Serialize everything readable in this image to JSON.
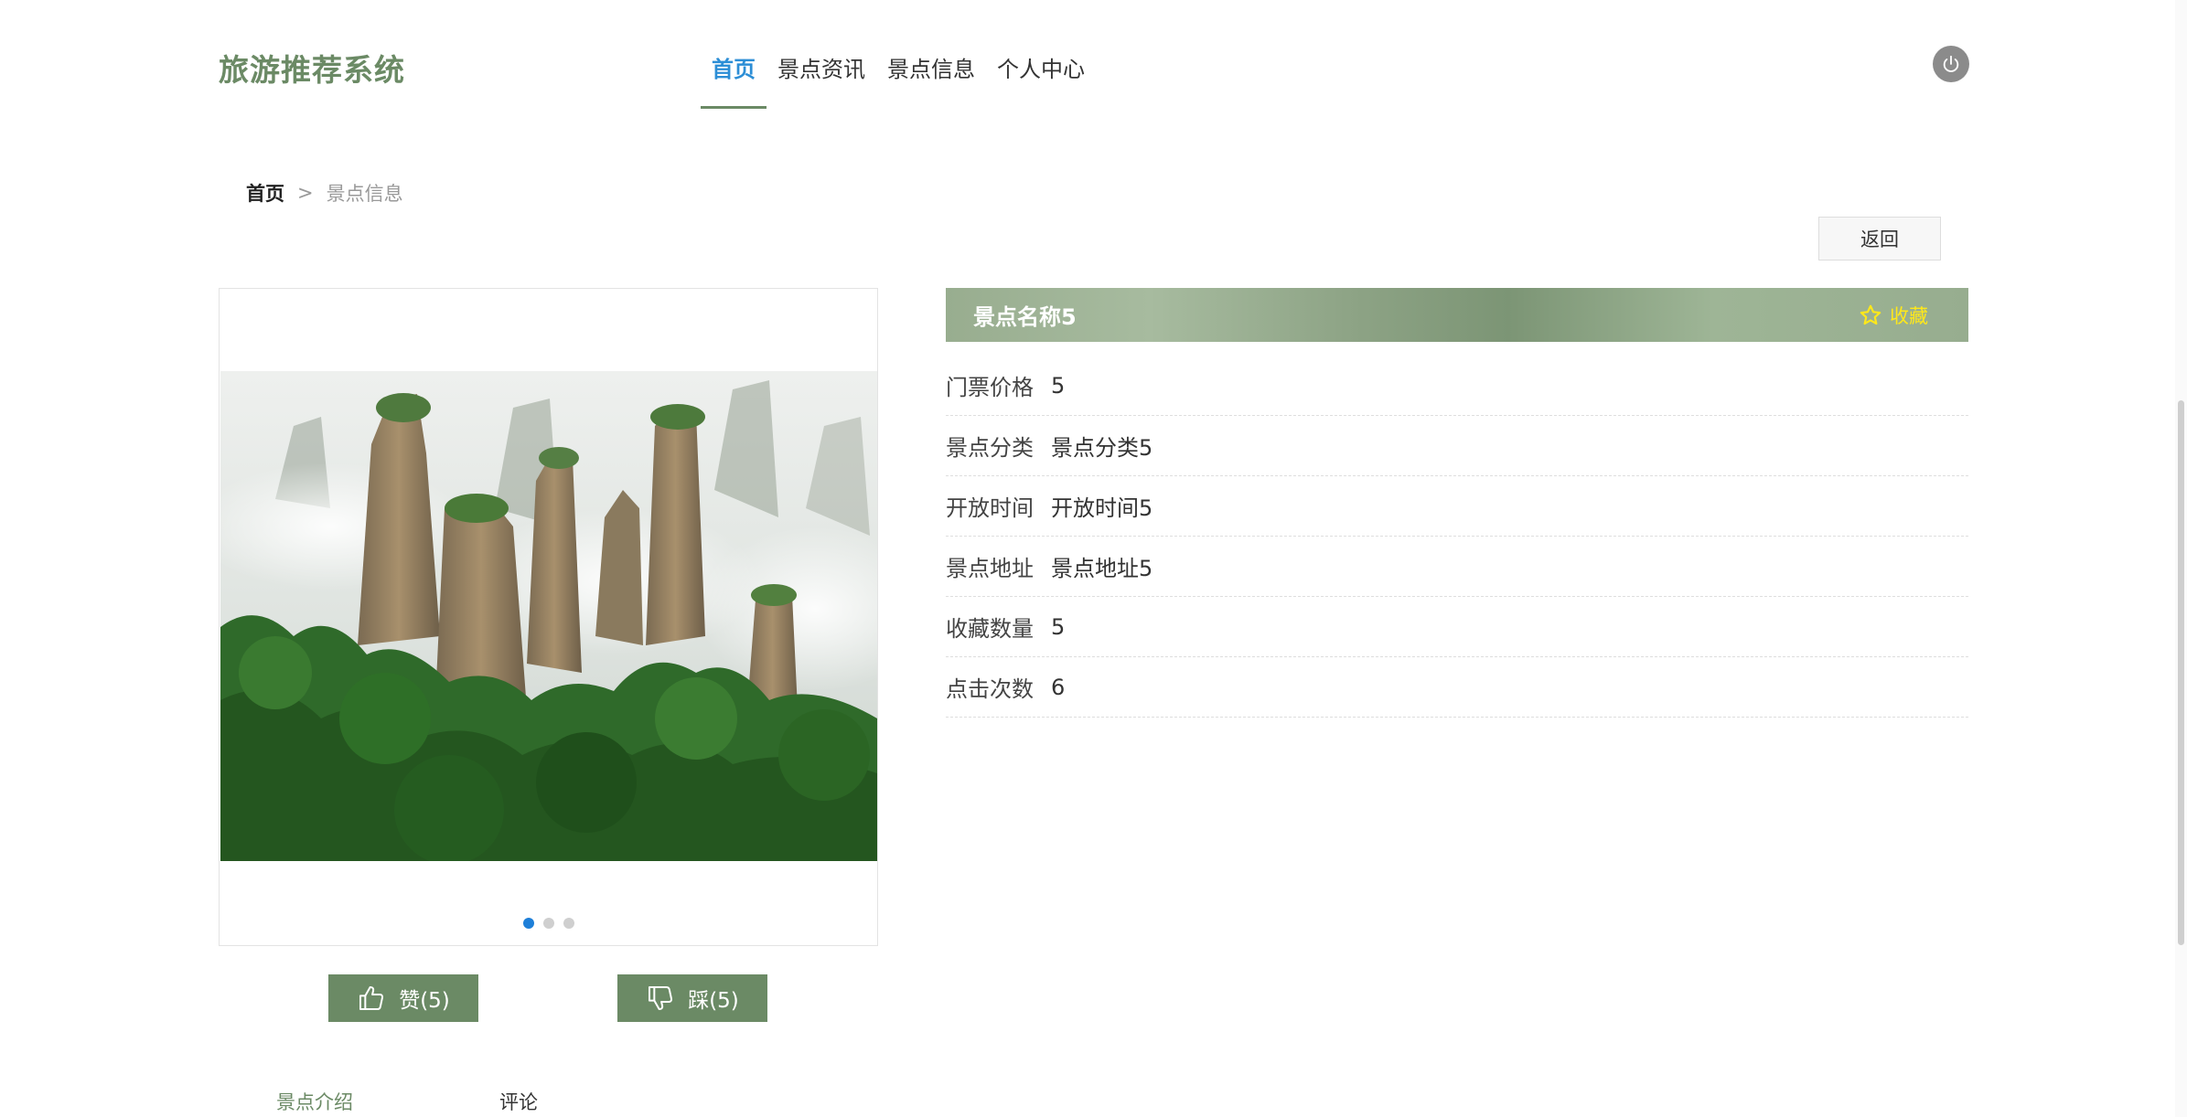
{
  "header": {
    "brand": "旅游推荐系统",
    "nav": [
      {
        "label": "首页",
        "active": true
      },
      {
        "label": "景点资讯",
        "active": false
      },
      {
        "label": "景点信息",
        "active": false
      },
      {
        "label": "个人中心",
        "active": false
      }
    ],
    "power_icon": "power-icon"
  },
  "breadcrumb": {
    "home": "首页",
    "separator": ">",
    "current": "景点信息"
  },
  "back_button": "返回",
  "carousel": {
    "image": "zhangjiajie-stone-pillars-photo",
    "active_index": 0,
    "slides": 3
  },
  "votes": {
    "like_label": "赞(5)",
    "dislike_label": "踩(5)"
  },
  "spot": {
    "name": "景点名称5",
    "favorite_label": "收藏",
    "details": [
      {
        "label": "门票价格",
        "value": "5"
      },
      {
        "label": "景点分类",
        "value": "景点分类5"
      },
      {
        "label": "开放时间",
        "value": "开放时间5"
      },
      {
        "label": "景点地址",
        "value": "景点地址5"
      },
      {
        "label": "收藏数量",
        "value": "5"
      },
      {
        "label": "点击次数",
        "value": "6"
      }
    ]
  },
  "tabs": {
    "intro": "景点介绍",
    "comments": "评论"
  },
  "colors": {
    "brand": "#6b8a65",
    "nav_active": "#2c8ed6",
    "favorite": "#ffe81a",
    "dot_active": "#1e7fd8"
  }
}
